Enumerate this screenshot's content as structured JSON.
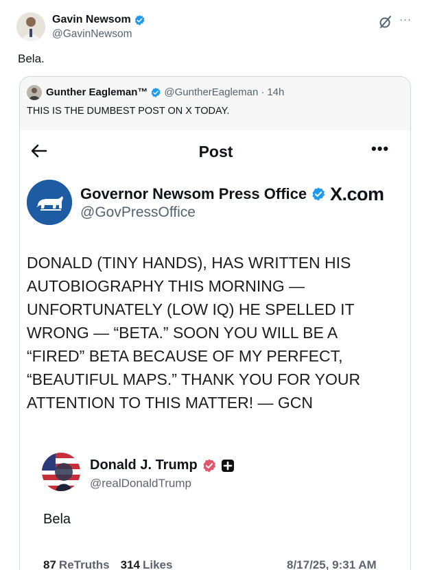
{
  "outer_post": {
    "author_name": "Gavin Newsom",
    "author_handle": "@GavinNewsom",
    "text": "Bela.",
    "more_icon": "more-horizontal-icon",
    "grok_icon": "grok-icon"
  },
  "quoted_post": {
    "author_name": "Gunther Eagleman™",
    "author_handle": "@GuntherEagleman",
    "time_sep": "·",
    "age": "14h",
    "text": "THIS IS THE DUMBEST POST ON X TODAY."
  },
  "screenshot": {
    "header_title": "Post",
    "back_icon": "arrow-left-icon",
    "brand": "X.com",
    "account_name": "Governor Newsom Press Office",
    "account_handle": "@GovPressOffice",
    "body_lines": [
      "DONALD (TINY HANDS), HAS WRITTEN HIS",
      "AUTOBIOGRAPHY THIS MORNING —",
      "UNFORTUNATELY (LOW IQ) HE SPELLED IT",
      "WRONG — “BETA.” SOON YOU WILL BE A",
      "“FIRED” BETA BECAUSE OF MY PERFECT,",
      "“BEAUTIFUL MAPS.” THANK YOU FOR YOUR",
      "ATTENTION TO THIS MATTER! — GCN"
    ],
    "truth": {
      "author_name": "Donald J. Trump",
      "author_handle": "@realDonaldTrump",
      "text": "Bela",
      "retruths_count": "87",
      "retruths_label": "ReTruths",
      "likes_count": "314",
      "likes_label": "Likes",
      "date": "8/17/25, 9:31 AM"
    }
  },
  "colors": {
    "verified_blue": "#1d9bf0",
    "truth_verified": "#e0566a",
    "muted": "#536471"
  }
}
